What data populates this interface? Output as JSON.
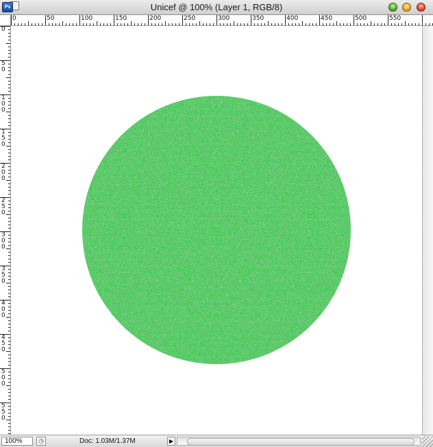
{
  "window": {
    "title": "Unicef @ 100% (Layer 1, RGB/8)",
    "app_icon_label": "Ps",
    "icon": "photoshop-document-icon"
  },
  "rulers": {
    "unit_step": 50,
    "top_labels": [
      "0",
      "50",
      "100",
      "150",
      "200",
      "250",
      "300",
      "350",
      "400",
      "450",
      "500",
      "550"
    ],
    "left_labels": [
      "0",
      "50",
      "100",
      "150",
      "200",
      "250",
      "300",
      "350",
      "400",
      "450",
      "500",
      "550"
    ]
  },
  "canvas": {
    "background": "#ffffff",
    "shape": "circle",
    "fill_color": "#36d14a",
    "noise_dark": "#0a6a14",
    "noise_light": "#a8f4b0"
  },
  "statusbar": {
    "zoom": "100%",
    "doc_info": "Doc: 1.03M/1.37M",
    "arrow_icon": "triangle-right-icon",
    "status_icon": "clock-icon"
  }
}
